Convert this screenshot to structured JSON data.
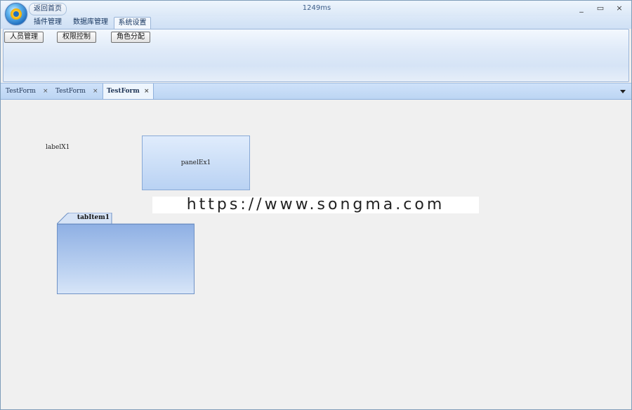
{
  "window": {
    "home_label": "返回首页",
    "title": "1249ms",
    "controls": {
      "minimize": "_",
      "maximize": "▭",
      "close": "×"
    }
  },
  "ribbon": {
    "tabs": [
      {
        "label": "插件管理"
      },
      {
        "label": "数据库管理"
      },
      {
        "label": "系统设置",
        "active": true
      }
    ],
    "buttons": [
      {
        "label": "人员管理"
      },
      {
        "label": "权限控制"
      },
      {
        "label": "角色分配"
      }
    ]
  },
  "doc_tabs": [
    {
      "label": "TestForm",
      "close": "×"
    },
    {
      "label": "TestForm",
      "close": "×"
    },
    {
      "label": "TestForm",
      "close": "×",
      "active": true
    }
  ],
  "form": {
    "label": "labelX1",
    "panel_text": "panelEx1",
    "tab_item": "tabItem1"
  },
  "watermark": "https://www.songma.com",
  "colors": {
    "ribbon_bg": "#dce9f8",
    "accent_border": "#8fb0dc",
    "tab_body_top": "#8fb0e4",
    "content_bg": "#f0f0f0"
  }
}
